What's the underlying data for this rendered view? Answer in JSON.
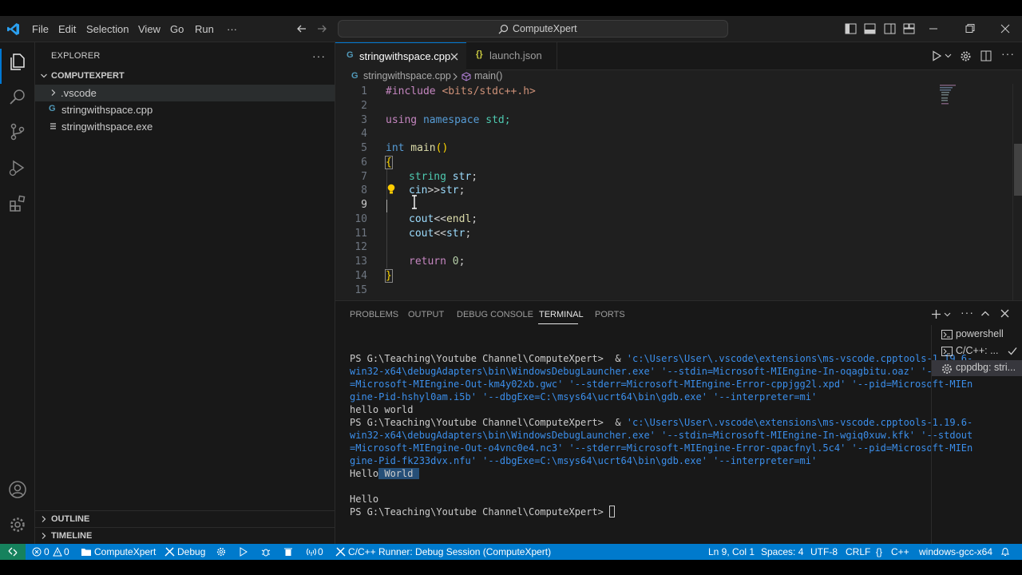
{
  "menu": [
    "File",
    "Edit",
    "Selection",
    "View",
    "Go",
    "Run",
    "···"
  ],
  "command_center": {
    "label": "ComputeXpert"
  },
  "sidebar": {
    "title": "EXPLORER",
    "more": "···",
    "folder": "COMPUTEXPERT",
    "items": [
      {
        "label": ".vscode",
        "kind": "folder"
      },
      {
        "label": "stringwithspace.cpp",
        "kind": "cpp-file"
      },
      {
        "label": "stringwithspace.exe",
        "kind": "exe-file"
      }
    ],
    "outline": "OUTLINE",
    "timeline": "TIMELINE"
  },
  "tabs": [
    {
      "label": "stringwithspace.cpp",
      "icon": "cpp-icon",
      "active": true
    },
    {
      "label": "launch.json",
      "icon": "json-icon",
      "active": false
    }
  ],
  "breadcrumb": {
    "file": "stringwithspace.cpp",
    "symbol": "main()"
  },
  "editor": {
    "line_numbers": [
      "1",
      "2",
      "3",
      "4",
      "5",
      "6",
      "7",
      "8",
      "9",
      "10",
      "11",
      "12",
      "13",
      "14",
      "15"
    ],
    "current_line": "9",
    "code": {
      "l1a": "#include",
      "l1b": " <bits/stdc++.h>",
      "l3a": "using",
      "l3b": " namespace",
      "l3c": " std;",
      "l5a": "int",
      "l5b": " main",
      "l5c": "()",
      "l6": "{",
      "l7a": "string",
      "l7b": " str",
      "l7c": ";",
      "l8a": "cin",
      "l8b": ">>",
      "l8c": "str",
      "l8d": ";",
      "l10a": "cout",
      "l10b": "<<",
      "l10c": "endl",
      "l10d": ";",
      "l11a": "cout",
      "l11b": "<<",
      "l11c": "str",
      "l11d": ";",
      "l13a": "return",
      "l13b": " 0",
      "l13c": ";",
      "l14": "}"
    }
  },
  "panel": {
    "tabs": [
      "PROBLEMS",
      "OUTPUT",
      "DEBUG CONSOLE",
      "TERMINAL",
      "PORTS"
    ],
    "active_tab": "TERMINAL",
    "terminal": {
      "l1a": "PS G:\\Teaching\\Youtube Channel\\ComputeXpert>  & ",
      "l1b": "'c:\\Users\\User\\.vscode\\extensions\\ms-vscode.cpptools-1.19.6-",
      "l2": "win32-x64\\debugAdapters\\bin\\WindowsDebugLauncher.exe' '--stdin=Microsoft-MIEngine-In-oqagbitu.oaz' '--stdout",
      "l3": "=Microsoft-MIEngine-Out-km4y02xb.gwc' '--stderr=Microsoft-MIEngine-Error-cppjgg2l.xpd' '--pid=Microsoft-MIEn",
      "l4": "gine-Pid-hshyl0am.i5b' '--dbgExe=C:\\msys64\\ucrt64\\bin\\gdb.exe' '--interpreter=mi'",
      "l5": "hello world",
      "l6a": "PS G:\\Teaching\\Youtube Channel\\ComputeXpert>  & ",
      "l6b": "'c:\\Users\\User\\.vscode\\extensions\\ms-vscode.cpptools-1.19.6-",
      "l7": "win32-x64\\debugAdapters\\bin\\WindowsDebugLauncher.exe' '--stdin=Microsoft-MIEngine-In-wgiq0xuw.kfk' '--stdout",
      "l8": "=Microsoft-MIEngine-Out-o4vnc0e4.nc3' '--stderr=Microsoft-MIEngine-Error-qpacfnyl.5c4' '--pid=Microsoft-MIEn",
      "l9": "gine-Pid-fk233dvx.nfu' '--dbgExe=C:\\msys64\\ucrt64\\bin\\gdb.exe' '--interpreter=mi'",
      "l10a": "Hello",
      "l10b": " World ",
      "l12": "Hello",
      "l13": "PS G:\\Teaching\\Youtube Channel\\ComputeXpert> "
    },
    "terminals": [
      {
        "label": "powershell"
      },
      {
        "label": "C/C++: ..."
      },
      {
        "label": "cppdbg: stri..."
      }
    ]
  },
  "statusbar": {
    "errors": "0",
    "warnings": "0",
    "project": "ComputeXpert",
    "debug": "Debug",
    "ports": "0",
    "runner": "C/C++ Runner: Debug Session (ComputeXpert)",
    "position": "Ln 9, Col 1",
    "spaces": "Spaces: 4",
    "encoding": "UTF-8",
    "eol": "CRLF",
    "language": "C++",
    "compiler": "windows-gcc-x64"
  },
  "colors": {
    "accent": "#0078d4",
    "statusbar": "#007acc",
    "remote": "#16825d"
  }
}
